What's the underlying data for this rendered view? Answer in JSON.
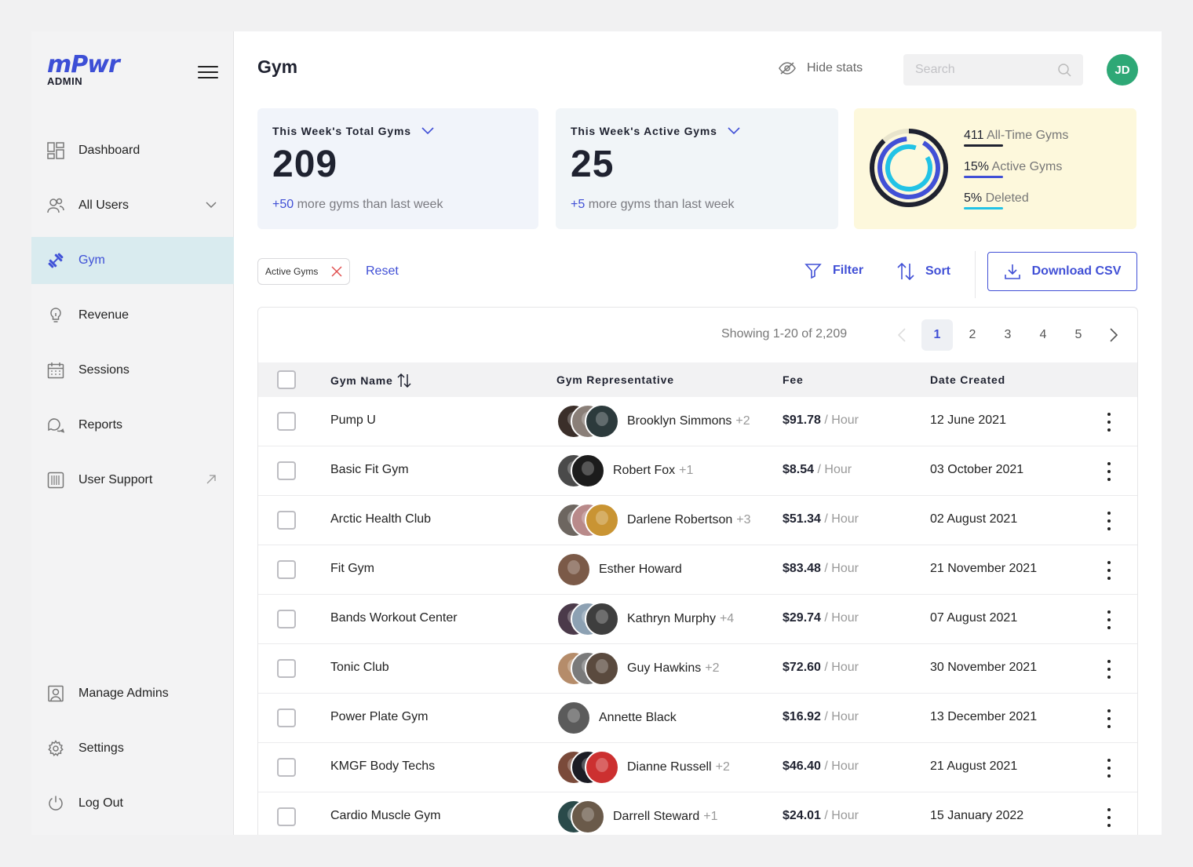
{
  "brand": {
    "logo": "mPwr",
    "sub": "ADMIN"
  },
  "nav": {
    "items": [
      {
        "label": "Dashboard"
      },
      {
        "label": "All Users"
      },
      {
        "label": "Gym"
      },
      {
        "label": "Revenue"
      },
      {
        "label": "Sessions"
      },
      {
        "label": "Reports"
      },
      {
        "label": "User Support"
      }
    ],
    "bottom": [
      {
        "label": "Manage Admins"
      },
      {
        "label": "Settings"
      },
      {
        "label": "Log Out"
      }
    ]
  },
  "header": {
    "title": "Gym",
    "hide_stats": "Hide stats",
    "search_placeholder": "Search",
    "user_initials": "JD"
  },
  "stats": {
    "total": {
      "title": "This Week's Total Gyms",
      "value": "209",
      "delta": "+50",
      "delta_text": " more gyms than last week"
    },
    "active": {
      "title": "This Week's Active Gyms",
      "value": "25",
      "delta": "+5",
      "delta_text": " more gyms than last week"
    },
    "breakdown": [
      {
        "value": "411",
        "label": " All-Time Gyms",
        "color": "#1f2230"
      },
      {
        "value": "15%",
        "label": " Active Gyms",
        "color": "#4150d6"
      },
      {
        "value": "5%",
        "label": " Deleted",
        "color": "#22c3e6"
      }
    ]
  },
  "filters": {
    "chip": "Active Gyms",
    "reset": "Reset",
    "filter": "Filter",
    "sort": "Sort",
    "download": "Download CSV"
  },
  "table": {
    "showing": "Showing 1-20 of 2,209",
    "pages": [
      "1",
      "2",
      "3",
      "4",
      "5"
    ],
    "current_page": "1",
    "columns": {
      "name": "Gym Name",
      "rep": "Gym Representative",
      "fee": "Fee",
      "date": "Date Created"
    },
    "rows": [
      {
        "name": "Pump U",
        "rep": "Brooklyn Simmons",
        "more": "+2",
        "fee": "$91.78",
        "unit": " / Hour",
        "date": "12 June 2021",
        "faces": [
          "#3b2f2a",
          "#8a7f78",
          "#2c3a3c"
        ]
      },
      {
        "name": "Basic Fit Gym",
        "rep": "Robert Fox",
        "more": "+1",
        "fee": "$8.54",
        "unit": " / Hour",
        "date": "03 October 2021",
        "faces": [
          "#4a4a4a",
          "#1c1c1c"
        ]
      },
      {
        "name": "Arctic Health Club",
        "rep": "Darlene Robertson",
        "more": "+3",
        "fee": "$51.34",
        "unit": " / Hour",
        "date": "02 August 2021",
        "faces": [
          "#6d6660",
          "#b98a8a",
          "#c99433"
        ]
      },
      {
        "name": "Fit Gym",
        "rep": "Esther Howard",
        "more": "",
        "fee": "$83.48",
        "unit": " / Hour",
        "date": "21 November 2021",
        "faces": [
          "#7b5a48"
        ]
      },
      {
        "name": "Bands Workout Center",
        "rep": "Kathryn Murphy",
        "more": "+4",
        "fee": "$29.74",
        "unit": " / Hour",
        "date": "07 August 2021",
        "faces": [
          "#4b3a4a",
          "#8da1b3",
          "#3e3e3e"
        ]
      },
      {
        "name": "Tonic Club",
        "rep": "Guy Hawkins",
        "more": "+2",
        "fee": "$72.60",
        "unit": " / Hour",
        "date": "30 November 2021",
        "faces": [
          "#b58c6a",
          "#7a7a7a",
          "#5a4a3e"
        ]
      },
      {
        "name": "Power Plate Gym",
        "rep": "Annette Black",
        "more": "",
        "fee": "$16.92",
        "unit": " / Hour",
        "date": "13 December 2021",
        "faces": [
          "#5b5b5b"
        ]
      },
      {
        "name": "KMGF Body Techs",
        "rep": "Dianne Russell",
        "more": "+2",
        "fee": "$46.40",
        "unit": " / Hour",
        "date": "21 August 2021",
        "faces": [
          "#7a4a3a",
          "#1c1c24",
          "#cc3030"
        ]
      },
      {
        "name": "Cardio Muscle Gym",
        "rep": "Darrell Steward",
        "more": "+1",
        "fee": "$24.01",
        "unit": " / Hour",
        "date": "15 January 2022",
        "faces": [
          "#2a4a4a",
          "#6a5a4a"
        ]
      }
    ]
  },
  "colors": {
    "accent": "#4150d6",
    "active_bg": "#d9ebef",
    "avatar": "#2ea876"
  }
}
